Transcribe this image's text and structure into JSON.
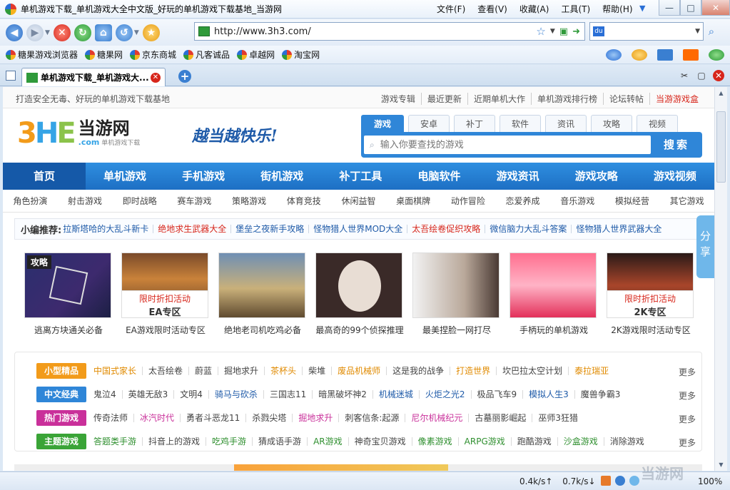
{
  "window": {
    "title": "单机游戏下载_单机游戏大全中文版_好玩的单机游戏下载基地_当游网",
    "menus": [
      "文件(F)",
      "查看(V)",
      "收藏(A)",
      "工具(T)",
      "帮助(H)"
    ],
    "controls": {
      "minimize": "—",
      "maximize": "□",
      "close": "✕"
    }
  },
  "navbar": {
    "url": "http://www.3h3.com/",
    "search_placeholder": ""
  },
  "favorites": [
    "糖果游戏浏览器",
    "糖果网",
    "京东商城",
    "凡客诚品",
    "卓越网",
    "淘宝网"
  ],
  "tab": {
    "title": "单机游戏下载_单机游戏大..."
  },
  "page": {
    "slogan": "打造安全无毒、好玩的单机游戏下载基地",
    "toplinks": [
      "游戏专辑",
      "最近更新",
      "近期单机大作",
      "单机游戏排行榜",
      "论坛转帖",
      "当游游戏盒"
    ],
    "logo": {
      "mark": "3HE",
      "name": "当游网",
      "sub_com": ".com",
      "sub_text": "单机游戏下载"
    },
    "brand_slogan": "越当越快乐!",
    "search_tabs": [
      "游戏",
      "安卓",
      "补丁",
      "软件",
      "资讯",
      "攻略",
      "视频"
    ],
    "search_placeholder": "输入你要查找的游戏",
    "search_button": "搜索",
    "main_nav": [
      "首页",
      "单机游戏",
      "手机游戏",
      "街机游戏",
      "补丁工具",
      "电脑软件",
      "游戏资讯",
      "游戏攻略",
      "游戏视频"
    ],
    "sub_nav": [
      "角色扮演",
      "射击游戏",
      "即时战略",
      "赛车游戏",
      "策略游戏",
      "体育竞技",
      "休闲益智",
      "桌面棋牌",
      "动作冒险",
      "恋爱养成",
      "音乐游戏",
      "模拟经营",
      "其它游戏"
    ],
    "recommend_label": "小编推荐:",
    "recommend": [
      {
        "text": "拉斯塔哈的大乱斗新卡",
        "color": "blue"
      },
      {
        "text": "绝地求生武器大全",
        "color": "red"
      },
      {
        "text": "堡垒之夜新手攻略",
        "color": "blue"
      },
      {
        "text": "怪物猎人世界MOD大全",
        "color": "blue"
      },
      {
        "text": "太吾绘卷促织攻略",
        "color": "red"
      },
      {
        "text": "微信脑力大乱斗答案",
        "color": "blue"
      },
      {
        "text": "怪物猎人世界武器大全",
        "color": "blue"
      }
    ],
    "share": "分享",
    "gallery": [
      {
        "caption": "逃离方块通关必备",
        "tag": "攻略"
      },
      {
        "caption": "EA游戏限时活动专区",
        "promo_top": "限时折扣活动",
        "promo_bottom": "EA专区"
      },
      {
        "caption": "绝地老司机吃鸡必备"
      },
      {
        "caption": "最高奇的99个侦探推理"
      },
      {
        "caption": "最美捏脸一网打尽"
      },
      {
        "caption": "手柄玩的单机游戏"
      },
      {
        "caption": "2K游戏限时活动专区",
        "promo_top": "限时折扣活动",
        "promo_bottom": "2K专区"
      }
    ],
    "categories": [
      {
        "label": "小型精品",
        "color": "#f29b1a",
        "items": [
          {
            "t": "中国式家长",
            "c": "#e08a00"
          },
          {
            "t": "太吾绘卷",
            "c": "#444"
          },
          {
            "t": "蔚蓝",
            "c": "#444"
          },
          {
            "t": "掘地求升",
            "c": "#444"
          },
          {
            "t": "茶杯头",
            "c": "#e08a00"
          },
          {
            "t": "柴堆",
            "c": "#444"
          },
          {
            "t": "废品机械师",
            "c": "#e08a00"
          },
          {
            "t": "这是我的战争",
            "c": "#444"
          },
          {
            "t": "打造世界",
            "c": "#e08a00"
          },
          {
            "t": "坎巴拉太空计划",
            "c": "#444"
          },
          {
            "t": "泰拉瑞亚",
            "c": "#e08a00"
          }
        ]
      },
      {
        "label": "中文经典",
        "color": "#2f86d8",
        "items": [
          {
            "t": "鬼泣4",
            "c": "#444"
          },
          {
            "t": "英雄无敌3",
            "c": "#444"
          },
          {
            "t": "文明4",
            "c": "#444"
          },
          {
            "t": "骑马与砍杀",
            "c": "#1e5aa8"
          },
          {
            "t": "三国志11",
            "c": "#444"
          },
          {
            "t": "暗黑破坏神2",
            "c": "#444"
          },
          {
            "t": "机械迷城",
            "c": "#1e5aa8"
          },
          {
            "t": "火炬之光2",
            "c": "#1e5aa8"
          },
          {
            "t": "极品飞车9",
            "c": "#444"
          },
          {
            "t": "模拟人生3",
            "c": "#1e5aa8"
          },
          {
            "t": "魔兽争霸3",
            "c": "#444"
          }
        ]
      },
      {
        "label": "热门游戏",
        "color": "#c9309a",
        "items": [
          {
            "t": "传奇法师",
            "c": "#444"
          },
          {
            "t": "冰汽时代",
            "c": "#c9309a"
          },
          {
            "t": "勇者斗恶龙11",
            "c": "#444"
          },
          {
            "t": "杀戮尖塔",
            "c": "#444"
          },
          {
            "t": "掘地求升",
            "c": "#c9309a"
          },
          {
            "t": "刺客信条:起源",
            "c": "#444"
          },
          {
            "t": "尼尔机械纪元",
            "c": "#c9309a"
          },
          {
            "t": "古墓丽影崛起",
            "c": "#444"
          },
          {
            "t": "巫师3狂猎",
            "c": "#444"
          }
        ]
      },
      {
        "label": "主题游戏",
        "color": "#3aa437",
        "items": [
          {
            "t": "答题类手游",
            "c": "#2f8f2f"
          },
          {
            "t": "抖音上的游戏",
            "c": "#444"
          },
          {
            "t": "吃鸡手游",
            "c": "#2f8f2f"
          },
          {
            "t": "猜成语手游",
            "c": "#444"
          },
          {
            "t": "AR游戏",
            "c": "#2f8f2f"
          },
          {
            "t": "神奇宝贝游戏",
            "c": "#444"
          },
          {
            "t": "像素游戏",
            "c": "#2f8f2f"
          },
          {
            "t": "ARPG游戏",
            "c": "#2f8f2f"
          },
          {
            "t": "跑酷游戏",
            "c": "#444"
          },
          {
            "t": "沙盒游戏",
            "c": "#2f8f2f"
          },
          {
            "t": "消除游戏",
            "c": "#444"
          }
        ]
      }
    ],
    "more": "更多"
  },
  "status": {
    "down": "0.4k/s↑",
    "up": "0.7k/s↓",
    "zoom": "100%",
    "watermark": "当游网"
  }
}
